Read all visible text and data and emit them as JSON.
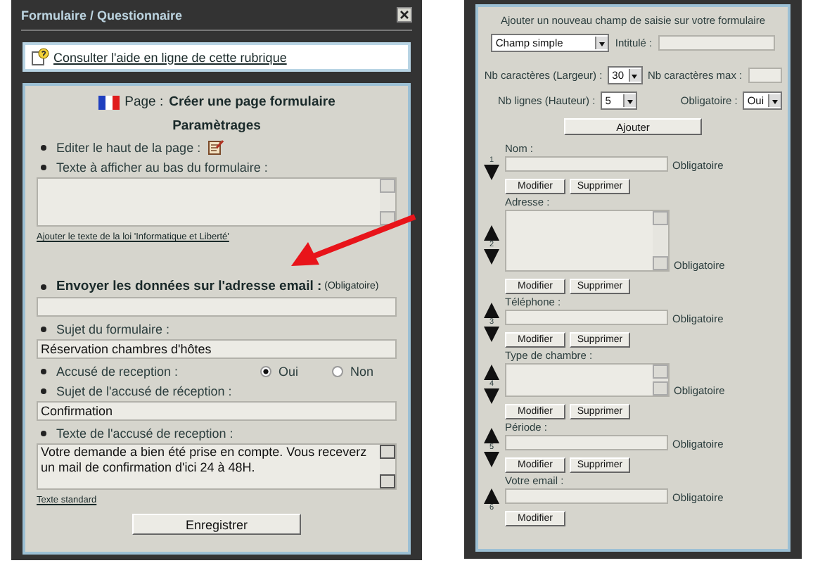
{
  "left_window": {
    "title": "Formulaire / Questionnaire",
    "help_link": "Consulter l'aide en ligne de cette rubrique",
    "page_label": "Page :",
    "page_title": "Créer une page formulaire",
    "section_title": "Paramètrages",
    "edit_header_label": "Editer le haut de la page :",
    "footer_label": "Texte à afficher au bas du formulaire :",
    "law_link": "Ajouter le texte de la loi 'Informatique et Liberté'",
    "email_label": "Envoyer les données sur l'adresse email :",
    "email_note": "(Obligatoire)",
    "subject": {
      "label": "Sujet du formulaire :",
      "value": "Réservation chambres d'hôtes"
    },
    "receipt": {
      "label": "Accusé de reception :",
      "options": [
        {
          "label": "Oui",
          "selected": true
        },
        {
          "label": "Non",
          "selected": false
        }
      ]
    },
    "receipt_subject": {
      "label": "Sujet de l'accusé de réception :",
      "value": "Confirmation"
    },
    "receipt_text": {
      "label": "Texte de l'accusé de reception :",
      "value": "Votre demande a bien été prise en compte. Vous receverz un mail de confirmation d'ici 24 à 48H."
    },
    "standard_link": "Texte standard",
    "save_button": "Enregistrer"
  },
  "right_window": {
    "heading": "Ajouter un nouveau champ de saisie sur votre formulaire",
    "type_select": "Champ simple",
    "title_label": "Intitulé :",
    "width_label": "Nb caractères (Largeur) :",
    "width_select": "30",
    "max_label": "Nb caractères max :",
    "lines_label": "Nb lignes (Hauteur) :",
    "lines_select": "5",
    "required_label": "Obligatoire :",
    "required_select": "Oui",
    "add_button": "Ajouter",
    "fields": [
      {
        "number": "1",
        "label": "Nom :",
        "kind": "text",
        "move_up": false,
        "move_down": true,
        "required": "Obligatoire",
        "buttons": [
          "Modifier",
          "Supprimer"
        ]
      },
      {
        "number": "2",
        "label": "Adresse :",
        "kind": "textarea",
        "move_up": true,
        "move_down": true,
        "required": "Obligatoire",
        "buttons": [
          "Modifier",
          "Supprimer"
        ]
      },
      {
        "number": "3",
        "label": "Téléphone :",
        "kind": "text",
        "move_up": true,
        "move_down": true,
        "required": "Obligatoire",
        "buttons": [
          "Modifier",
          "Supprimer"
        ]
      },
      {
        "number": "4",
        "label": "Type de chambre :",
        "kind": "list",
        "move_up": true,
        "move_down": true,
        "required": "Obligatoire",
        "buttons": [
          "Modifier",
          "Supprimer"
        ]
      },
      {
        "number": "5",
        "label": "Période :",
        "kind": "text",
        "move_up": true,
        "move_down": true,
        "required": "Obligatoire",
        "buttons": [
          "Modifier",
          "Supprimer"
        ]
      },
      {
        "number": "6",
        "label": "Votre email :",
        "kind": "text",
        "move_up": true,
        "move_down": false,
        "required": "Obligatoire",
        "buttons": [
          "Modifier"
        ]
      }
    ]
  }
}
